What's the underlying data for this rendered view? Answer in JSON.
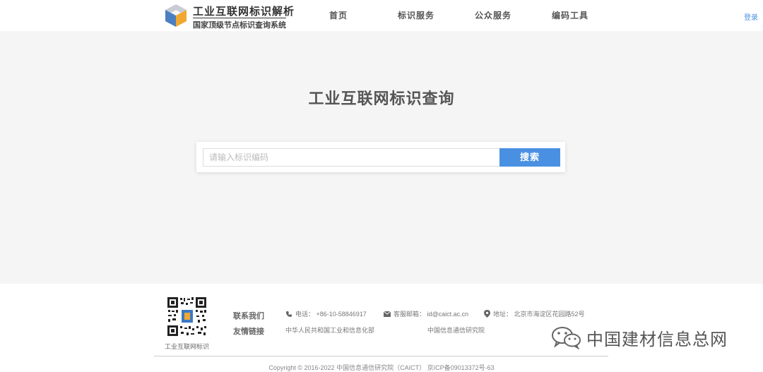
{
  "header": {
    "logo_title": "工业互联网标识解析",
    "logo_subtitle": "国家顶级节点标识查询系统",
    "nav": [
      "首页",
      "标识服务",
      "公众服务",
      "编码工具"
    ],
    "login": "登录"
  },
  "hero": {
    "title": "工业互联网标识查询",
    "search_placeholder": "请输入标识编码",
    "search_button": "搜索"
  },
  "footer": {
    "qr_label": "工业互联网标识",
    "contact_heading": "联系我们",
    "links_heading": "友情链接",
    "phone": "电话：  +86-10-58846917",
    "email": "客服邮箱：  id@caict.ac.cn",
    "address": "地址：  北京市海淀区花园路52号",
    "link1": "中华人民共和国工业和信息化部",
    "link2": "中国信息通信研究院",
    "copyright": "Copyright © 2016-2022 中国信息通信研究院（CAICT）   京ICP备09013372号-63"
  },
  "watermark": {
    "text": "中国建材信息总网"
  },
  "colors": {
    "accent": "#4a90e2",
    "hero_bg": "#f5f5f5"
  }
}
